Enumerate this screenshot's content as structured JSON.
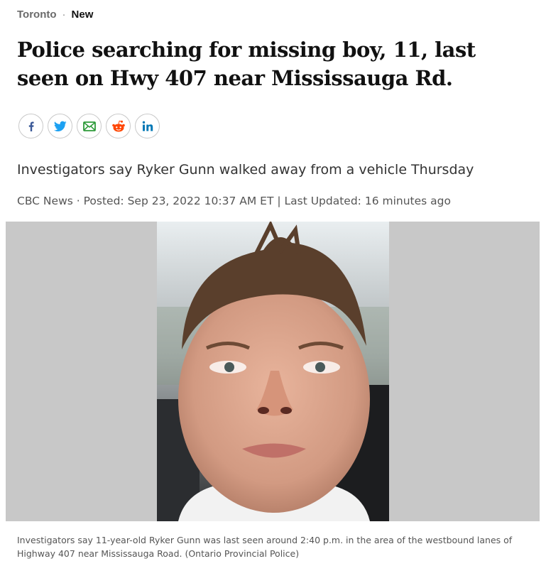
{
  "breadcrumb": {
    "section": "Toronto",
    "separator": "·",
    "tag": "New"
  },
  "headline": "Police searching for missing boy, 11, last seen on Hwy 407 near Mississauga Rd.",
  "share": [
    {
      "name": "facebook-icon",
      "color": "#3b5998"
    },
    {
      "name": "twitter-icon",
      "color": "#1da1f2"
    },
    {
      "name": "email-icon",
      "color": "#2e9b3a"
    },
    {
      "name": "reddit-icon",
      "color": "#ff4500"
    },
    {
      "name": "linkedin-icon",
      "color": "#0077b5"
    }
  ],
  "deck": "Investigators say Ryker Gunn walked away from a vehicle Thursday",
  "byline": {
    "source": "CBC News",
    "sep1": " · ",
    "posted": "Posted: Sep 23, 2022 10:37 AM ET",
    "sep2": " | ",
    "updated": "Last Updated: 16 minutes ago"
  },
  "photo": {
    "subject": "portrait of missing boy"
  },
  "caption": "Investigators say 11-year-old Ryker Gunn was last seen around 2:40 p.m. in the area of the westbound lanes of Highway 407 near Mississauga Road. (Ontario Provincial Police)"
}
